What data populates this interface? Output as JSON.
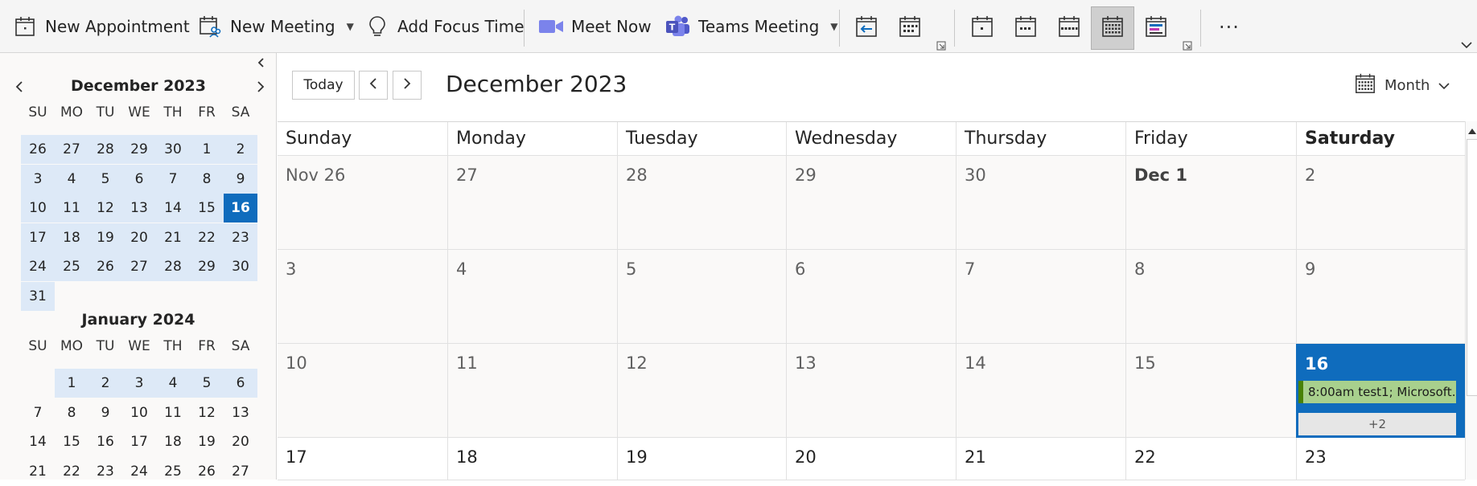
{
  "ribbon": {
    "new_appointment": "New Appointment",
    "new_meeting": "New Meeting",
    "add_focus_time": "Add Focus Time",
    "meet_now": "Meet Now",
    "teams_meeting": "Teams Meeting",
    "more": "···"
  },
  "mini_calendars": [
    {
      "title": "December 2023",
      "dow": [
        "SU",
        "MO",
        "TU",
        "WE",
        "TH",
        "FR",
        "SA"
      ],
      "weeks": [
        [
          "26",
          "27",
          "28",
          "29",
          "30",
          "1",
          "2"
        ],
        [
          "3",
          "4",
          "5",
          "6",
          "7",
          "8",
          "9"
        ],
        [
          "10",
          "11",
          "12",
          "13",
          "14",
          "15",
          "16"
        ],
        [
          "17",
          "18",
          "19",
          "20",
          "21",
          "22",
          "23"
        ],
        [
          "24",
          "25",
          "26",
          "27",
          "28",
          "29",
          "30"
        ],
        [
          "31",
          "",
          "",
          "",
          "",
          "",
          ""
        ]
      ],
      "today": "16"
    },
    {
      "title": "January 2024",
      "dow": [
        "SU",
        "MO",
        "TU",
        "WE",
        "TH",
        "FR",
        "SA"
      ],
      "weeks": [
        [
          "",
          "1",
          "2",
          "3",
          "4",
          "5",
          "6"
        ],
        [
          "7",
          "8",
          "9",
          "10",
          "11",
          "12",
          "13"
        ],
        [
          "14",
          "15",
          "16",
          "17",
          "18",
          "19",
          "20"
        ],
        [
          "21",
          "22",
          "23",
          "24",
          "25",
          "26",
          "27"
        ]
      ]
    }
  ],
  "main": {
    "today_button": "Today",
    "title": "December 2023",
    "view_label": "Month"
  },
  "month": {
    "days": [
      "Sunday",
      "Monday",
      "Tuesday",
      "Wednesday",
      "Thursday",
      "Friday",
      "Saturday"
    ],
    "current_day": "Saturday",
    "weeks": [
      [
        "Nov 26",
        "27",
        "28",
        "29",
        "30",
        "Dec 1",
        "2"
      ],
      [
        "3",
        "4",
        "5",
        "6",
        "7",
        "8",
        "9"
      ],
      [
        "10",
        "11",
        "12",
        "13",
        "14",
        "15",
        "16"
      ],
      [
        "17",
        "18",
        "19",
        "20",
        "21",
        "22",
        "23"
      ]
    ],
    "today_label": "16",
    "event": "8:00am test1; Microsoft...",
    "more_events": "+2"
  },
  "colors": {
    "accent": "#0f6cbd",
    "selected_range": "#dde9f7",
    "event_bg": "#a8d08d",
    "event_bar": "#498205"
  }
}
